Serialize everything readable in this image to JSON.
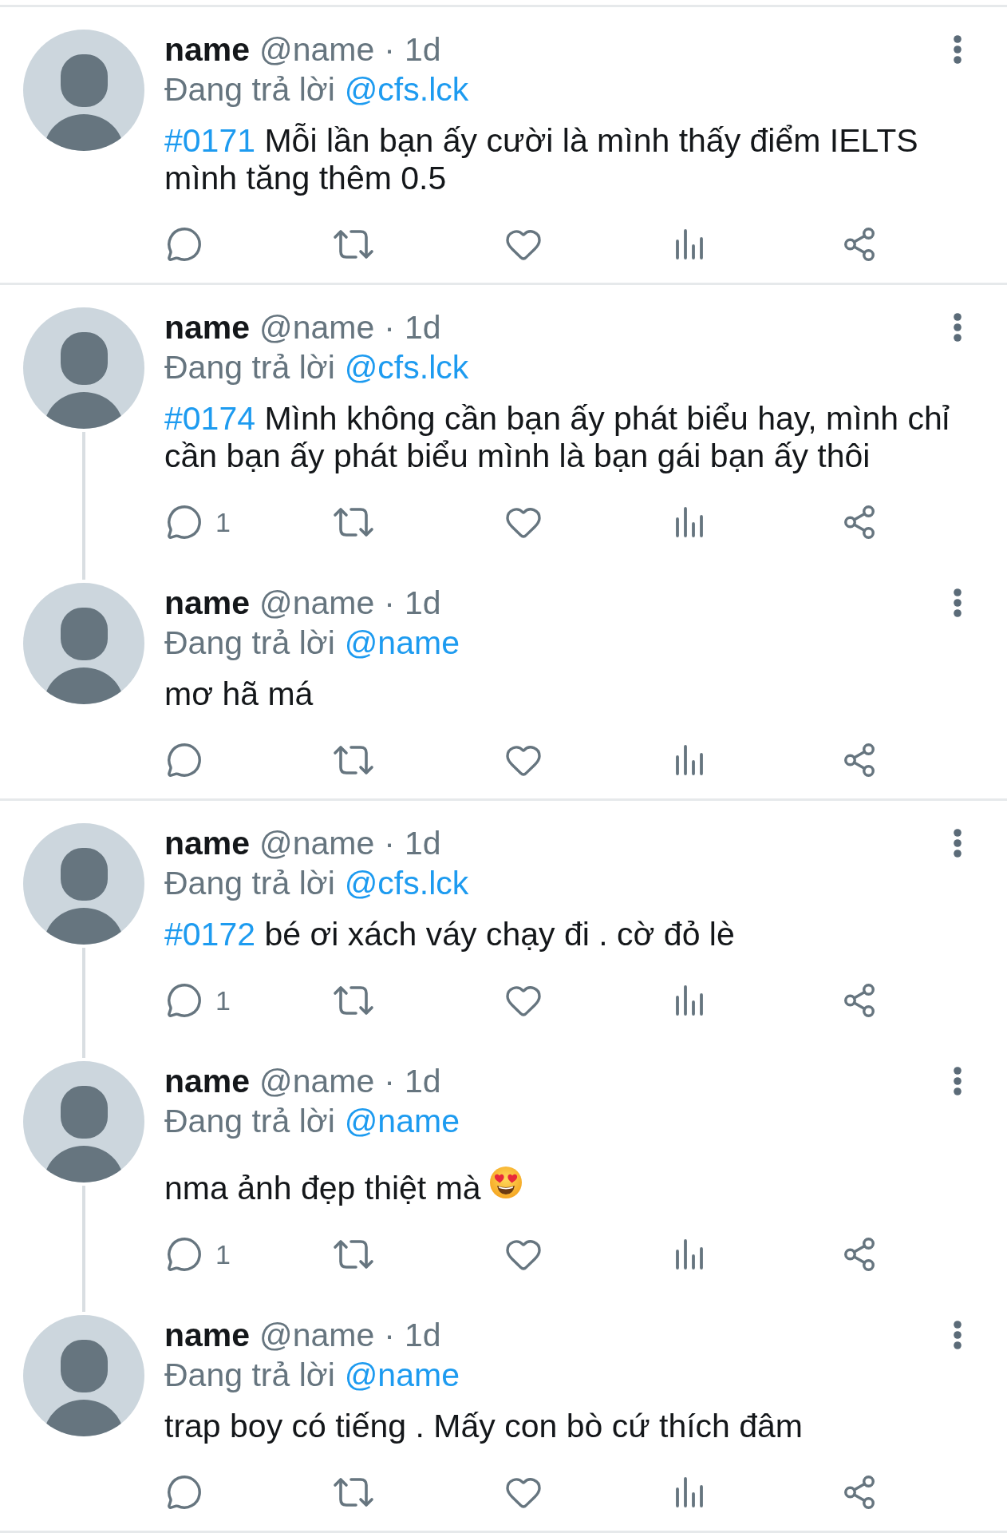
{
  "threads": [
    {
      "tweets": [
        {
          "name": "name",
          "handle": "@name",
          "separator": "·",
          "time": "1d",
          "reply_to": {
            "label": "Đang trả lời",
            "mention": "@cfs.lck"
          },
          "body": {
            "hashtag": "#0171",
            "text": "Mỗi lần bạn ấy cười là mình thấy điểm IELTS mình tăng thêm 0.5"
          },
          "actions": [
            {
              "kind": "reply"
            },
            {
              "kind": "retweet"
            },
            {
              "kind": "like"
            },
            {
              "kind": "views"
            },
            {
              "kind": "share"
            }
          ]
        }
      ]
    },
    {
      "tweets": [
        {
          "name": "name",
          "handle": "@name",
          "separator": "·",
          "time": "1d",
          "reply_to": {
            "label": "Đang trả lời",
            "mention": "@cfs.lck"
          },
          "body": {
            "hashtag": "#0174",
            "text": "Mình không cần bạn ấy phát biểu hay, mình chỉ cần bạn ấy phát biểu mình là bạn gái bạn ấy thôi"
          },
          "actions": [
            {
              "kind": "reply",
              "count": "1"
            },
            {
              "kind": "retweet"
            },
            {
              "kind": "like"
            },
            {
              "kind": "views"
            },
            {
              "kind": "share"
            }
          ]
        },
        {
          "name": "name",
          "handle": "@name",
          "separator": "·",
          "time": "1d",
          "reply_to": {
            "label": "Đang trả lời",
            "mention": "@name"
          },
          "body": {
            "text": "mơ hã má"
          },
          "actions": [
            {
              "kind": "reply"
            },
            {
              "kind": "retweet"
            },
            {
              "kind": "like"
            },
            {
              "kind": "views"
            },
            {
              "kind": "share"
            }
          ]
        }
      ]
    },
    {
      "tweets": [
        {
          "name": "name",
          "handle": "@name",
          "separator": "·",
          "time": "1d",
          "reply_to": {
            "label": "Đang trả lời",
            "mention": "@cfs.lck"
          },
          "body": {
            "hashtag": "#0172",
            "text": "bé ơi xách váy chạy đi . cờ đỏ lè"
          },
          "actions": [
            {
              "kind": "reply",
              "count": "1"
            },
            {
              "kind": "retweet"
            },
            {
              "kind": "like"
            },
            {
              "kind": "views"
            },
            {
              "kind": "share"
            }
          ]
        },
        {
          "name": "name",
          "handle": "@name",
          "separator": "·",
          "time": "1d",
          "reply_to": {
            "label": "Đang trả lời",
            "mention": "@name"
          },
          "body": {
            "text": "nma ảnh đẹp thiệt mà",
            "emoji": true
          },
          "actions": [
            {
              "kind": "reply",
              "count": "1"
            },
            {
              "kind": "retweet"
            },
            {
              "kind": "like"
            },
            {
              "kind": "views"
            },
            {
              "kind": "share"
            }
          ]
        },
        {
          "name": "name",
          "handle": "@name",
          "separator": "·",
          "time": "1d",
          "reply_to": {
            "label": "Đang trả lời",
            "mention": "@name"
          },
          "body": {
            "text": "trap boy có tiếng . Mấy con bò cứ thích đâm"
          },
          "actions": [
            {
              "kind": "reply"
            },
            {
              "kind": "retweet"
            },
            {
              "kind": "like"
            },
            {
              "kind": "views"
            },
            {
              "kind": "share"
            }
          ]
        }
      ]
    }
  ]
}
